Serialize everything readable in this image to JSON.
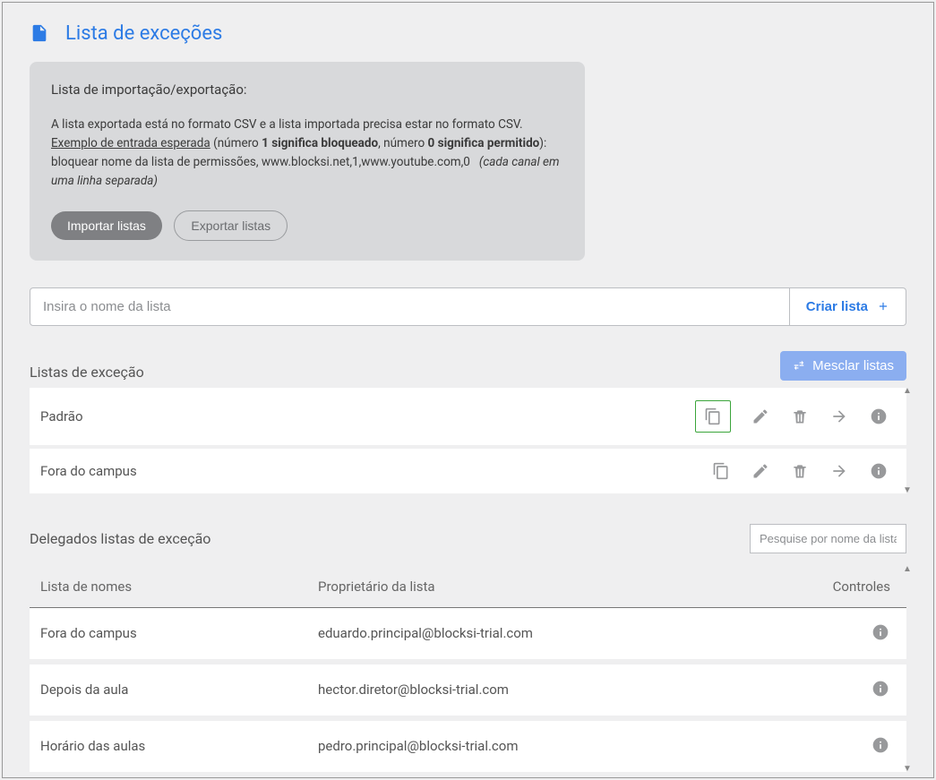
{
  "page": {
    "title": "Lista de exceções"
  },
  "import_box": {
    "heading": "Lista de importação/exportação:",
    "p1": "A lista exportada está no formato CSV e a lista importada precisa estar no formato CSV.",
    "p2_link": "Exemplo de entrada esperada",
    "p2_mid1": " (número ",
    "p2_b1": "1 significa bloqueado",
    "p2_mid2": ", número ",
    "p2_b2": "0 significa permitido",
    "p2_end": "):",
    "p3_text": "bloquear nome da lista de permissões, www.blocksi.net,1,www.youtube.com,0",
    "p3_note": "(cada canal em uma linha separada)",
    "btn_import": "Importar listas",
    "btn_export": "Exportar listas"
  },
  "create": {
    "placeholder": "Insira o nome da lista",
    "button": "Criar lista"
  },
  "exception_lists": {
    "title": "Listas de exceção",
    "merge_button": "Mesclar listas",
    "rows": [
      {
        "name": "Padrão",
        "highlighted": true
      },
      {
        "name": "Fora do campus",
        "highlighted": false
      }
    ]
  },
  "delegated": {
    "title": "Delegados listas de exceção",
    "search_placeholder": "Pesquise por nome da lista ou",
    "header": {
      "name": "Lista de nomes",
      "owner": "Proprietário da lista",
      "controls": "Controles"
    },
    "rows": [
      {
        "name": "Fora do campus",
        "owner": "eduardo.principal@blocksi-trial.com"
      },
      {
        "name": "Depois da aula",
        "owner": "hector.diretor@blocksi-trial.com"
      },
      {
        "name": "Horário das aulas",
        "owner": "pedro.principal@blocksi-trial.com"
      }
    ]
  }
}
